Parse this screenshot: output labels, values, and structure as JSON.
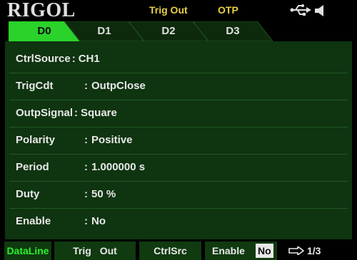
{
  "header": {
    "brand": "RIGOL",
    "status": [
      "Trig Out",
      "OTP"
    ],
    "icons": [
      "usb-icon",
      "speaker-icon"
    ],
    "status_color": "#e8d04a"
  },
  "tabs": [
    {
      "label": "D0",
      "active": true
    },
    {
      "label": "D1",
      "active": false
    },
    {
      "label": "D2",
      "active": false
    },
    {
      "label": "D3",
      "active": false
    }
  ],
  "settings": [
    {
      "label": "CtrlSource",
      "value": "CH1"
    },
    {
      "label": "TrigCdt",
      "value": "OutpClose"
    },
    {
      "label": "OutpSignal",
      "value": "Square"
    },
    {
      "label": "Polarity",
      "value": "Positive"
    },
    {
      "label": "Period",
      "value": "1.000000 s"
    },
    {
      "label": "Duty",
      "value": "50 %"
    },
    {
      "label": "Enable",
      "value": "No"
    }
  ],
  "softkeys": {
    "dataline": "DataLine",
    "trig": "Trig",
    "out": "Out",
    "ctrlsrc": "CtrlSrc",
    "enable": "Enable",
    "enable_value": "No",
    "page": "1/3"
  },
  "colors": {
    "panel": "#0f3410",
    "active_tab": "#2ad22a",
    "selected_key": "#2cf02c"
  }
}
